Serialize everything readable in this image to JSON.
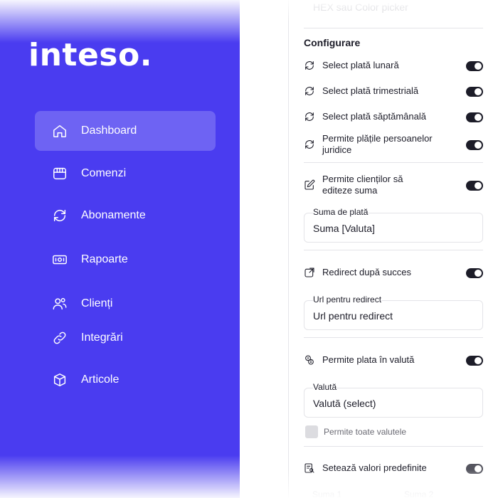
{
  "sidebar": {
    "logo": "inteso.",
    "items": [
      {
        "label": "Dashboard",
        "icon": "home-icon",
        "active": true
      },
      {
        "label": "Comenzi",
        "icon": "store-icon"
      },
      {
        "label": "Abonamente",
        "icon": "refresh-icon"
      },
      {
        "label": "Rapoarte",
        "icon": "money-icon"
      },
      {
        "label": "Clienți",
        "icon": "users-icon"
      },
      {
        "label": "Integrări",
        "icon": "link-icon"
      },
      {
        "label": "Articole",
        "icon": "box-icon"
      }
    ]
  },
  "panel": {
    "hex_hint": "HEX sau Color picker",
    "section_title": "Configurare",
    "options": [
      {
        "label": "Select plată lunară",
        "icon": "refresh-icon",
        "on": true
      },
      {
        "label": "Select plată trimestrială",
        "icon": "refresh-icon",
        "on": true
      },
      {
        "label": "Select plată săptămânală",
        "icon": "refresh-icon",
        "on": true
      },
      {
        "label": "Permite plățile persoanelor juridice",
        "icon": "refresh-icon",
        "on": true
      },
      {
        "label": "Permite clienților să editeze suma",
        "icon": "edit-icon",
        "on": true
      },
      {
        "label": "Redirect după succes",
        "icon": "redirect-icon",
        "on": true
      },
      {
        "label": "Permite plata în valută",
        "icon": "currency-icon",
        "on": true
      },
      {
        "label": "Setează valori predefinite",
        "icon": "list-search-icon",
        "on": true
      }
    ],
    "fields": {
      "suma": {
        "label": "Suma de plată",
        "value": "Suma [Valuta]"
      },
      "url": {
        "label": "Url pentru redirect",
        "value": "Url pentru redirect"
      },
      "valuta": {
        "label": "Valută",
        "value": "Valută (select)"
      }
    },
    "checkbox_label": "Permite toate valutele",
    "bottom_labels": [
      "Suma 1",
      "Suma 2"
    ]
  },
  "colors": {
    "sidebar": "#4a3cf0",
    "toggle_on": "#1c1c28",
    "text": "#1c1c28"
  }
}
